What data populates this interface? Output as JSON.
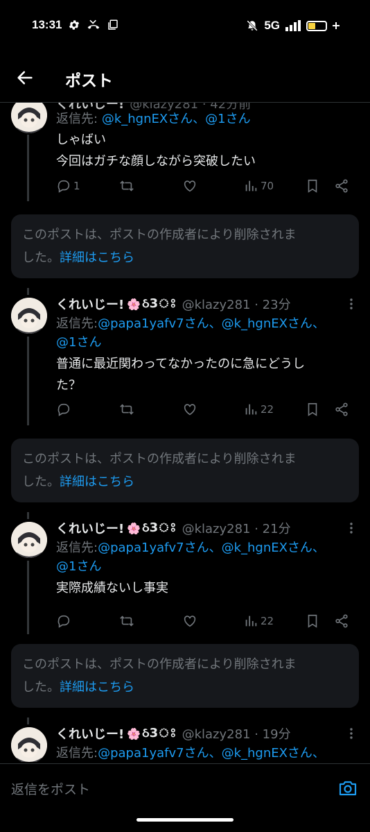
{
  "status_bar": {
    "time": "13:31",
    "network": "5G"
  },
  "header": {
    "title": "ポスト"
  },
  "tweets": [
    {
      "name": "くれいじー!",
      "meta": "@klazy281 · 42分前",
      "reply_prefix": "返信先:",
      "mentions": "@k_hgnEXさん、@1さん",
      "text_lines": [
        "しゃばい",
        "今回はガチな顔しながら突破したい"
      ],
      "stats": {
        "replies": "1",
        "views": "70"
      }
    },
    {
      "name": "くれいじー!",
      "emoji": "🌸",
      "symbol": "ઠ3ঃ",
      "meta": "@klazy281 · 23分",
      "reply_prefix": "返信先:",
      "mentions_line1": "@papa1yafv7さん、@k_hgnEXさん、",
      "mentions_line2": "@1さん",
      "text_lines": [
        "普通に最近関わってなかったのに急にどうし",
        "た？"
      ],
      "stats": {
        "views": "22"
      }
    },
    {
      "name": "くれいじー!",
      "emoji": "🌸",
      "symbol": "ઠ3ঃ",
      "meta": "@klazy281 · 21分",
      "reply_prefix": "返信先:",
      "mentions_line1": "@papa1yafv7さん、@k_hgnEXさん、",
      "mentions_line2": "@1さん",
      "text_lines": [
        "実際成績ないし事実"
      ],
      "stats": {
        "views": "22"
      }
    },
    {
      "name": "くれいじー!",
      "emoji": "🌸",
      "symbol": "ઠ3ঃ",
      "meta": "@klazy281 · 19分",
      "reply_prefix": "返信先:",
      "mentions_line1": "@papa1yafv7さん、@k_hgnEXさん、"
    }
  ],
  "deleted_notice": {
    "line1": "このポストは、ポストの作成者により削除されま",
    "line2_prefix": "した。",
    "link": "詳細はこちら"
  },
  "reply_bar": {
    "placeholder": "返信をポスト"
  },
  "colors": {
    "accent": "#1d9bf0",
    "muted": "#71767b",
    "background": "#000000",
    "card": "#16181c",
    "battery": "#f7d23e"
  }
}
